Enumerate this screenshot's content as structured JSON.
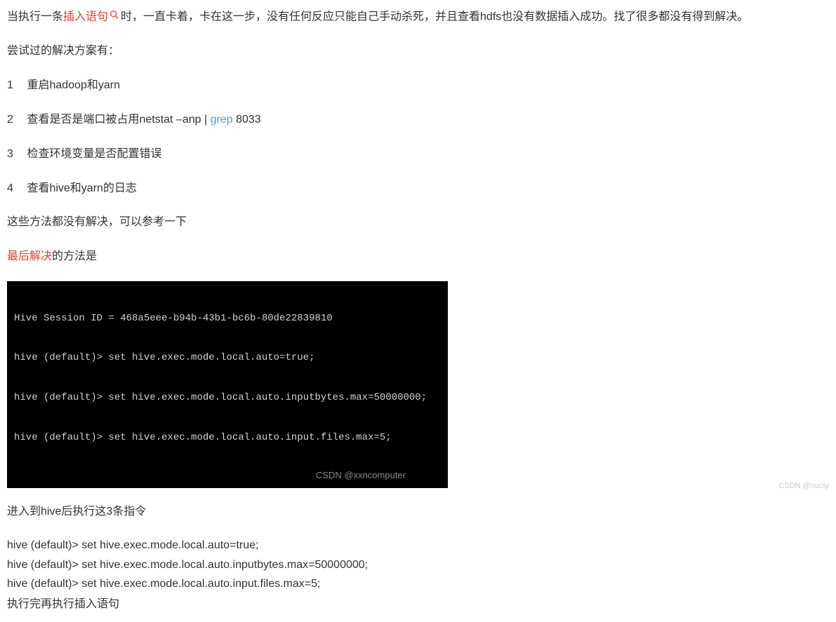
{
  "intro": {
    "prefix": "当执行一条",
    "highlight": "插入语句",
    "suffix": "时，一直卡着，卡在这一步，没有任何反应只能自己手动杀死，并且查看hdfs也没有数据插入成功。找了很多都没有得到解决。"
  },
  "tried_heading": "尝试过的解决方案有：",
  "list": [
    {
      "num": "1",
      "text": "重启hadoop和yarn"
    },
    {
      "num": "2",
      "prefix": "查看是否是端口被占用netstat –anp | ",
      "link": "grep",
      "suffix": " 8033"
    },
    {
      "num": "3",
      "text": "检查环境变量是否配置错误"
    },
    {
      "num": "4",
      "text": "查看hive和yarn的日志"
    }
  ],
  "not_solved": "这些方法都没有解决，可以参考一下",
  "final": {
    "highlight": "最后解决",
    "suffix": "的方法是"
  },
  "terminal": {
    "lines": [
      "Hive Session ID = 468a5eee-b94b-43b1-bc6b-80de22839810",
      "hive (default)> set hive.exec.mode.local.auto=true;",
      "hive (default)> set hive.exec.mode.local.auto.inputbytes.max=50000000;",
      "hive (default)> set hive.exec.mode.local.auto.input.files.max=5;"
    ],
    "watermark": "CSDN @xxncomputer"
  },
  "enter_hive": "进入到hive后执行这3条指令",
  "commands": [
    "hive (default)> set hive.exec.mode.local.auto=true;",
    "hive (default)> set hive.exec.mode.local.auto.inputbytes.max=50000000;",
    "hive (default)> set hive.exec.mode.local.auto.input.files.max=5;"
  ],
  "exec_after": "执行完再执行插入语句",
  "footer_watermark": "CSDN @nucty"
}
